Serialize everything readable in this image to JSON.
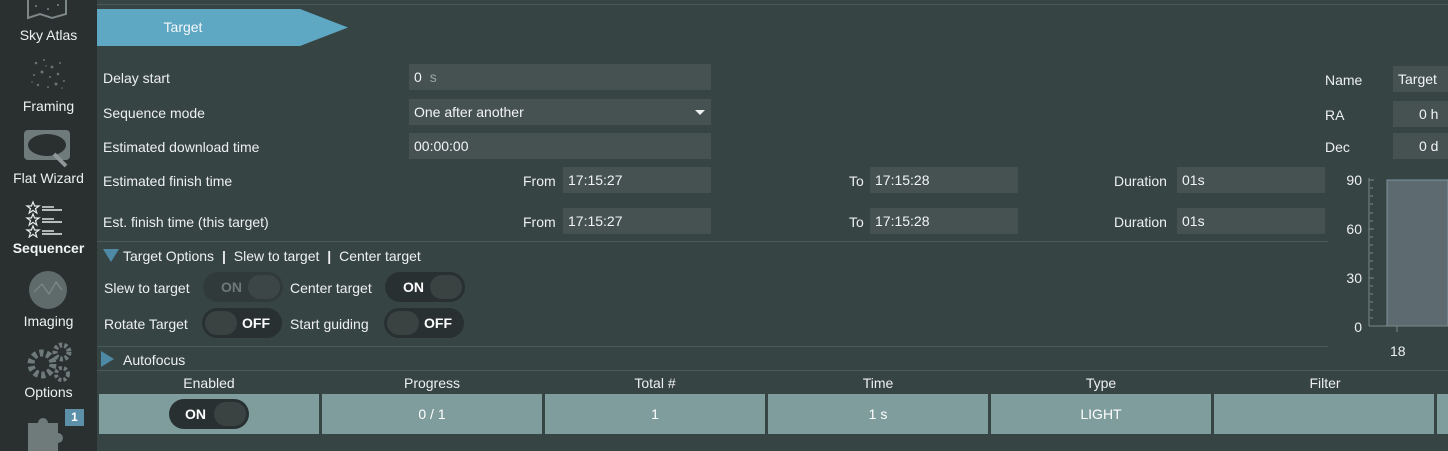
{
  "sidebar": {
    "items": [
      {
        "label": "Sky Atlas",
        "icon": "sky-atlas-icon"
      },
      {
        "label": "Framing",
        "icon": "framing-icon"
      },
      {
        "label": "Flat Wizard",
        "icon": "flat-wizard-icon"
      },
      {
        "label": "Sequencer",
        "icon": "sequencer-icon"
      },
      {
        "label": "Imaging",
        "icon": "imaging-icon"
      },
      {
        "label": "Options",
        "icon": "options-icon"
      }
    ],
    "plugin_badge": "1"
  },
  "header": {
    "target_tab": "Target"
  },
  "form": {
    "delay_start_label": "Delay start",
    "delay_start_value": "0",
    "delay_start_unit": "s",
    "sequence_mode_label": "Sequence mode",
    "sequence_mode_value": "One after another",
    "est_download_label": "Estimated download time",
    "est_download_value": "00:00:00",
    "est_finish_label": "Estimated finish time",
    "est_finish_target_label": "Est. finish time (this target)",
    "from_label": "From",
    "to_label": "To",
    "duration_label": "Duration",
    "est_finish_from": "17:15:27",
    "est_finish_to": "17:15:28",
    "est_finish_duration": "01s",
    "est_target_from": "17:15:27",
    "est_target_to": "17:15:28",
    "est_target_duration": "01s"
  },
  "target_info": {
    "name_label": "Name",
    "name_value": "Target",
    "ra_label": "RA",
    "ra_value": "0 h",
    "dec_label": "Dec",
    "dec_value": "0 d"
  },
  "target_options": {
    "header": "Target Options",
    "sep": "|",
    "slew_summary": "Slew to target",
    "center_summary": "Center target",
    "slew_label": "Slew to target",
    "slew_state": "ON",
    "center_label": "Center target",
    "center_state": "ON",
    "rotate_label": "Rotate Target",
    "rotate_state": "OFF",
    "guiding_label": "Start guiding",
    "guiding_state": "OFF"
  },
  "autofocus": {
    "header": "Autofocus"
  },
  "table": {
    "headers": [
      "Enabled",
      "Progress",
      "Total #",
      "Time",
      "Type",
      "Filter"
    ],
    "row": {
      "enabled": "ON",
      "progress": "0 / 1",
      "total": "1",
      "time": "1 s",
      "type": "LIGHT",
      "filter": ""
    }
  },
  "chart_data": {
    "type": "area",
    "title": "",
    "xlabel": "",
    "ylabel": "",
    "ylim": [
      0,
      90
    ],
    "yticks": [
      "90",
      "60",
      "30",
      "0"
    ],
    "xticks": [
      "18"
    ]
  },
  "colors": {
    "accent": "#5ea8c4",
    "panel": "#374444",
    "sidebar": "#2a2f30",
    "table_cell": "#7f9d9c"
  }
}
